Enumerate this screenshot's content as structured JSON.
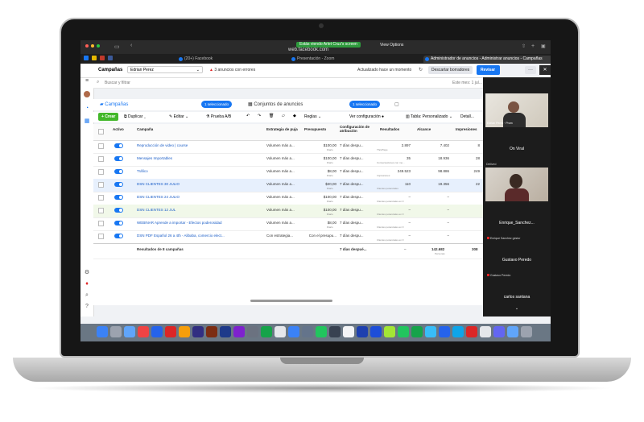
{
  "browser": {
    "zoom_banner": "Estás viendo Arlet Cruz's screen",
    "view_options": "View Options",
    "url": "web.facebook.com",
    "tabs": [
      {
        "label": "(20+) Facebook"
      },
      {
        "label": "Presentación - Zoom"
      },
      {
        "label": "Administrador de anuncios - Administrar anuncios - Campañas"
      }
    ]
  },
  "header": {
    "section": "Campañas",
    "account": "Edrian Perez",
    "warning": "3 anuncios con errores",
    "updated": "Actualizado hace un momento",
    "discard": "Descartar borradores",
    "publish": "Revisar y publicar (5)",
    "more": "···"
  },
  "search": {
    "placeholder": "Buscar y filtrar",
    "right": "Este mes: 1 jul..."
  },
  "levels": {
    "campaigns": "Campañas",
    "campaigns_badge": "1 seleccionado",
    "adsets": "Conjuntos de anuncios",
    "adsets_badge": "1 seleccionado"
  },
  "toolbar": {
    "create": "Crear",
    "duplicate": "Duplicar",
    "edit": "Editar",
    "abtest": "Prueba A/B",
    "rules": "Reglas",
    "view_config": "Ver configuración",
    "table": "Tabla: Personalizado",
    "detail": "Detall..."
  },
  "table": {
    "headers": {
      "active": "Activo",
      "campaign": "Campaña",
      "bid": "Estrategia de puja",
      "budget": "Presupuesto",
      "attribution": "Configuración de atribución",
      "results": "Resultados",
      "reach": "Alcance",
      "impressions": "Impresiones"
    },
    "rows": [
      {
        "name": "Reproducción de video | course",
        "bid": "Volumen más a...",
        "budget": "$100,00",
        "budget_sub": "Diario",
        "attr": "7 días despu...",
        "results": "2.897",
        "results_sub": "ThruPlays",
        "reach": "7.402",
        "imp": "8"
      },
      {
        "name": "Mensajes Importables",
        "bid": "Volumen más a...",
        "budget": "$100,00",
        "budget_sub": "Diario",
        "attr": "7 días despu...",
        "results": "35",
        "results_sub": "Conversaciones con me...",
        "reach": "18.936",
        "imp": "28"
      },
      {
        "name": "Tráfico",
        "bid": "Volumen más a...",
        "budget": "$8,00",
        "budget_sub": "Diario",
        "attr": "7 días despu...",
        "results": "249.523",
        "results_sub": "Impresiones",
        "reach": "98.886",
        "imp": "249"
      },
      {
        "name": "DSN CLIENTES 30 JULIO",
        "bid": "Volumen más a...",
        "budget": "$20,00",
        "budget_sub": "Diario",
        "attr": "7 días despu...",
        "results": "110",
        "results_sub": "Clientes potenciales",
        "reach": "19.356",
        "imp": "22"
      },
      {
        "name": "DSN CLIENTES 24 JULIO",
        "bid": "Volumen más a...",
        "budget": "$100,00",
        "budget_sub": "Diario",
        "attr": "7 días despu...",
        "results": "–",
        "results_sub": "Clientes potenciales en F",
        "reach": "–",
        "imp": ""
      },
      {
        "name": "DSN CLIENTES 12 JUL",
        "bid": "Volumen más a...",
        "budget": "$100,00",
        "budget_sub": "Diario",
        "attr": "7 días despu...",
        "results": "–",
        "results_sub": "Clientes potenciales en F",
        "reach": "–",
        "imp": ""
      },
      {
        "name": "WEBINAR Aprende a importar - Efectos poderosidad",
        "bid": "Volumen más a...",
        "budget": "$8,00",
        "budget_sub": "Diario",
        "attr": "7 días despu...",
        "results": "–",
        "results_sub": "Clientes potenciales en F",
        "reach": "–",
        "imp": ""
      },
      {
        "name": "DSN PDF Español 26 a 4th - Alibaba, comercio elect...",
        "bid": "Con estrategia...",
        "budget": "Con el presupu...",
        "budget_sub": "",
        "attr": "7 días despu...",
        "results": "–",
        "results_sub": "Clientes potenciales en F",
        "reach": "–",
        "imp": ""
      }
    ],
    "summary": {
      "label": "Resultados de 8 campañas",
      "attr": "7 días despué...",
      "results": "–",
      "reach": "142.682",
      "reach_sub": "Personas",
      "imp": "308"
    }
  },
  "zoom_panel": {
    "participants": [
      {
        "name": "On Viral",
        "tag": "Edrian Perez ·  Prom"
      },
      {
        "name": "Enrique_Sanchez...",
        "tag": "Enrique Sanchez gestor"
      },
      {
        "name": "Gustavo Peredo",
        "tag": "Gustavo Peredo"
      },
      {
        "name": "carlos santana",
        "tag": ""
      }
    ],
    "tile_label_mid": "Deilived",
    "chevron": "⌄"
  },
  "colors": {
    "accent": "#1877f2",
    "zoom_green": "#2e9b3d",
    "dock": "#6a7784"
  }
}
